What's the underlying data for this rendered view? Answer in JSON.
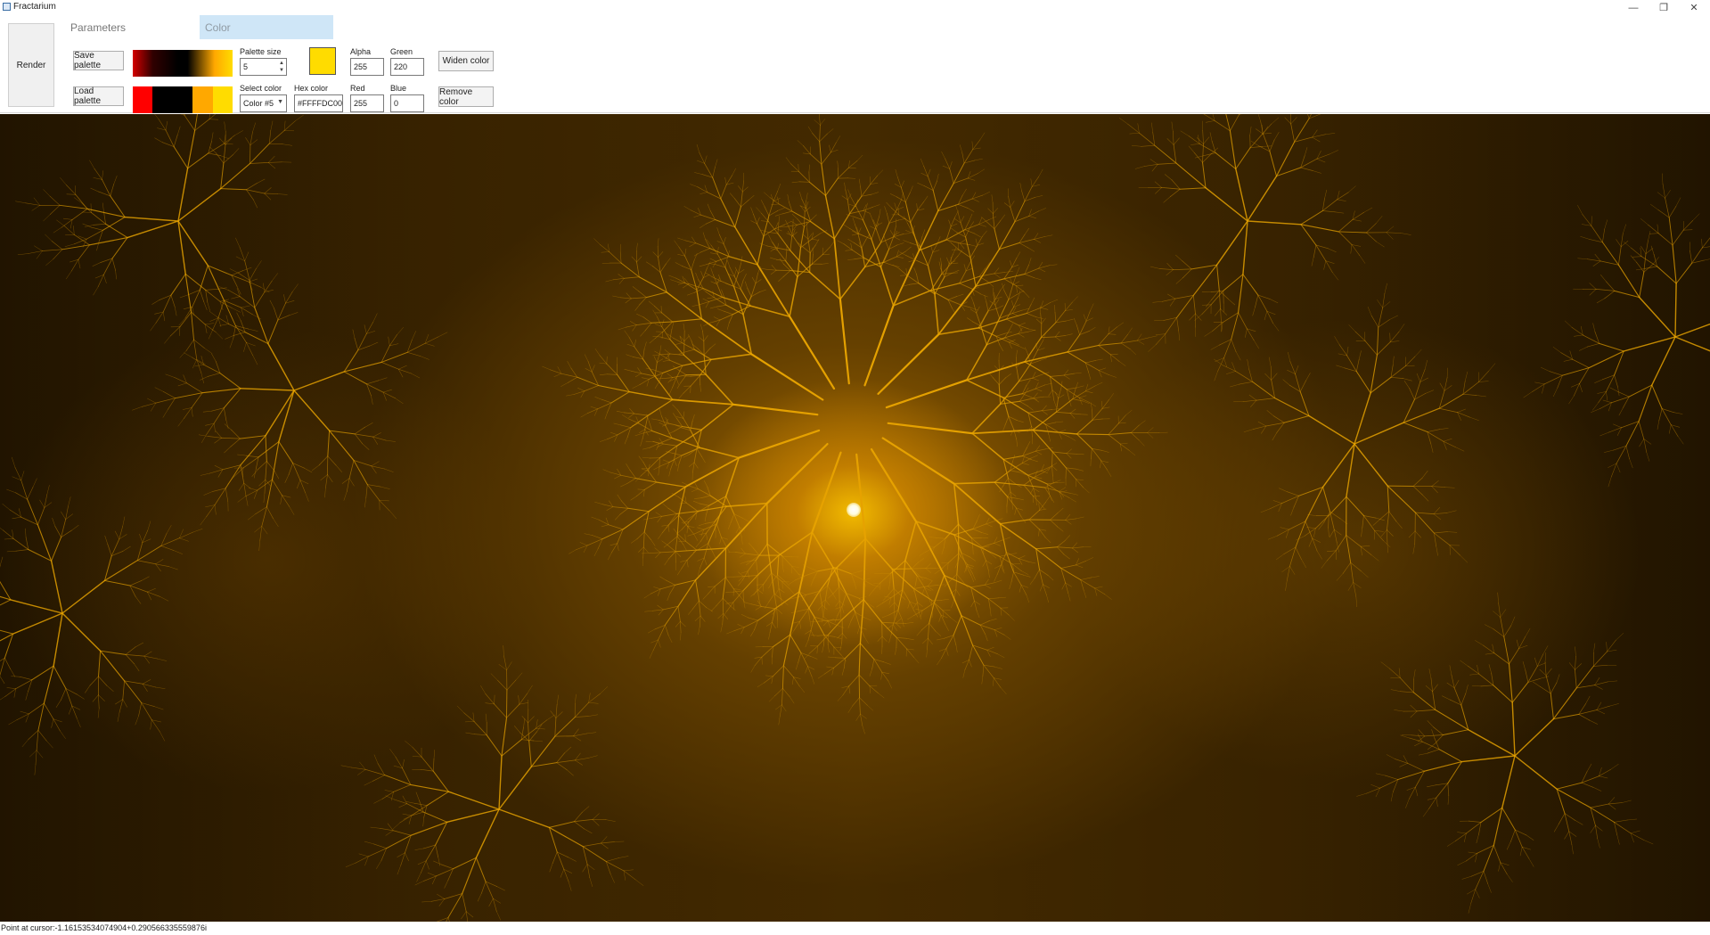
{
  "window": {
    "title": "Fractarium",
    "controls": {
      "minimize": "—",
      "restore": "❐",
      "close": "✕"
    }
  },
  "toolbar": {
    "render_label": "Render",
    "tabs": [
      {
        "label": "Parameters",
        "selected": false
      },
      {
        "label": "Color",
        "selected": true
      }
    ],
    "save_palette_label": "Save palette",
    "load_palette_label": "Load palette",
    "palette_size": {
      "label": "Palette size",
      "value": "5"
    },
    "select_color": {
      "label": "Select color",
      "value": "Color #5"
    },
    "hex_color": {
      "label": "Hex color",
      "value": "#FFFFDC00"
    },
    "alpha": {
      "label": "Alpha",
      "value": "255"
    },
    "red": {
      "label": "Red",
      "value": "255"
    },
    "green": {
      "label": "Green",
      "value": "220"
    },
    "blue": {
      "label": "Blue",
      "value": "0"
    },
    "widen_color_label": "Widen color",
    "remove_color_label": "Remove color",
    "selected_color_hex": "#FFDC00",
    "palette_colors": [
      "#FF0000",
      "#000000",
      "#000000",
      "#FFA800",
      "#FFDC00"
    ]
  },
  "canvas": {
    "description": "Julia set fractal rendered in black-to-gold palette",
    "accent": "#FFB800"
  },
  "status": {
    "text": "Point at cursor:-1.16153534074904+0.290566335559876i"
  }
}
